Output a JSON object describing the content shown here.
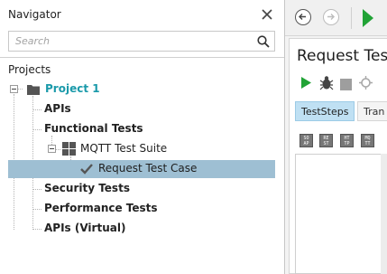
{
  "navigator": {
    "title": "Navigator",
    "search_placeholder": "Search",
    "projects_label": "Projects",
    "tree": {
      "project": "Project 1",
      "apis": "APIs",
      "functional_tests": "Functional Tests",
      "suite": "MQTT Test Suite",
      "test_case": "Request Test Case",
      "security_tests": "Security Tests",
      "performance_tests": "Performance Tests",
      "apis_virtual": "APIs (Virtual)"
    }
  },
  "editor": {
    "title": "Request Test Case",
    "tabs": [
      {
        "label": "TestSteps",
        "active": true
      },
      {
        "label": "Tran",
        "active": false
      }
    ],
    "step_buttons": [
      "SO\nAP",
      "RE\nST",
      "HT\nTP",
      "MQ\nTT"
    ]
  },
  "colors": {
    "project_text": "#1b9aaa",
    "selection": "#9ebfd3",
    "run_green": "#21a336",
    "active_tab": "#bfe0f3"
  }
}
